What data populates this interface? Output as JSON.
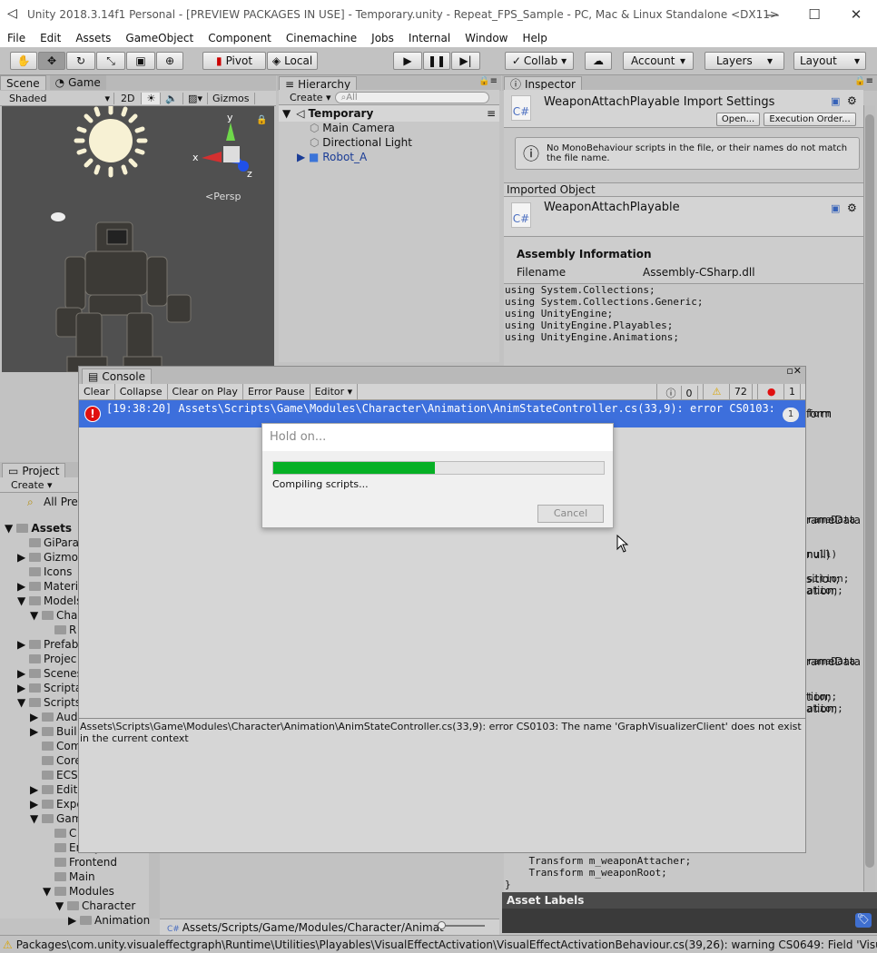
{
  "window": {
    "title": "Unity 2018.3.14f1 Personal - [PREVIEW PACKAGES IN USE] - Temporary.unity - Repeat_FPS_Sample - PC, Mac & Linux Standalone <DX11>"
  },
  "menu": [
    "File",
    "Edit",
    "Assets",
    "GameObject",
    "Component",
    "Cinemachine",
    "Jobs",
    "Internal",
    "Window",
    "Help"
  ],
  "toolbar": {
    "pivot": "Pivot",
    "local": "Local",
    "collab": "Collab ▾",
    "account": "Account",
    "layers": "Layers",
    "layout": "Layout"
  },
  "scene": {
    "tab_scene": "Scene",
    "tab_game": "Game",
    "shading": "Shaded",
    "mode2d": "2D",
    "gizmos": "Gizmos",
    "persp": "Persp"
  },
  "hierarchy": {
    "tab": "Hierarchy",
    "create": "Create",
    "search_placeholder": "All",
    "scene_name": "Temporary",
    "items": [
      "Main Camera",
      "Directional Light",
      "Robot_A"
    ]
  },
  "inspector": {
    "tab": "Inspector",
    "import_title": "WeaponAttachPlayable Import Settings",
    "open_btn": "Open...",
    "exec_btn": "Execution Order...",
    "warning": "No MonoBehaviour scripts in the file, or their names do not match the file name.",
    "imported_object": "Imported Object",
    "script_name": "WeaponAttachPlayable",
    "assembly_header": "Assembly Information",
    "filename_label": "Filename",
    "filename_value": "Assembly-CSharp.dll",
    "code_top": [
      "using System.Collections;",
      "using System.Collections.Generic;",
      "using UnityEngine;",
      "using UnityEngine.Playables;",
      "using UnityEngine.Animations;"
    ],
    "code_right": [
      "form",
      "rameData",
      "null)",
      "sition;",
      "ation;",
      "rameData",
      "tion;",
      "ation;"
    ],
    "code_bottom": [
      "    Transform m_weaponAttacher;",
      "    Transform m_weaponRoot;",
      "}"
    ],
    "asset_labels": "Asset Labels"
  },
  "console": {
    "tab": "Console",
    "buttons": [
      "Clear",
      "Collapse",
      "Clear on Play",
      "Error Pause",
      "Editor ▾"
    ],
    "count_info": "0",
    "count_warn": "72",
    "count_err": "1",
    "entry": "[19:38:20] Assets\\Scripts\\Game\\Modules\\Character\\Animation\\AnimStateController.cs(33,9): error CS0103: The name 'GraphVisualizerClient' does not exist in the current context",
    "entry_count": "1",
    "detail": "Assets\\Scripts\\Game\\Modules\\Character\\Animation\\AnimStateController.cs(33,9): error CS0103: The name 'GraphVisualizerClient' does not exist in the current context"
  },
  "dialog": {
    "title": "Hold on...",
    "status": "Compiling scripts...",
    "cancel": "Cancel",
    "progress": 0.49
  },
  "project": {
    "tab": "Project",
    "create": "Create",
    "all_prefabs": "All Pre",
    "tree": [
      "Assets",
      "GiPara",
      "Gizmo",
      "Icons",
      "Materi",
      "Models",
      "Cha",
      "R",
      "Prefab",
      "Projec",
      "Scenes",
      "Scripta",
      "Scripts",
      "Aud",
      "Buil",
      "Com",
      "Core",
      "ECS",
      "Edito",
      "Expe",
      "Gam",
      "C",
      "Entity",
      "Frontend",
      "Main",
      "Modules",
      "Character",
      "Animation"
    ],
    "path": "Assets/Scripts/Game/Modules/Character/Animat"
  },
  "statusbar": {
    "text": "Packages\\com.unity.visualeffectgraph\\Runtime\\Utilities\\Playables\\VisualEffectActivation\\VisualEffectActivationBehaviour.cs(39,26): warning CS0649: Field 'VisualEffe"
  },
  "colors": {
    "selection": "#3d6fdc",
    "progress": "#06b025",
    "error": "#e01010"
  }
}
